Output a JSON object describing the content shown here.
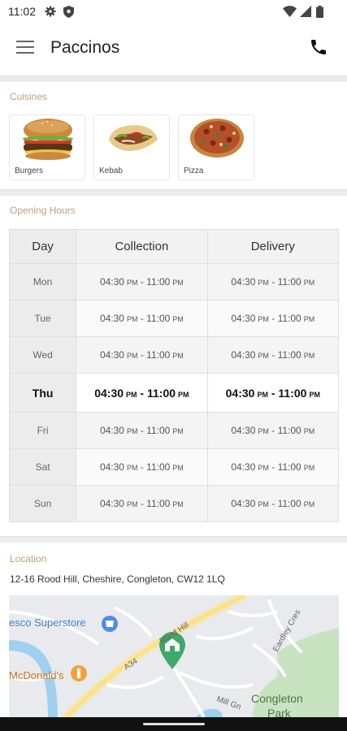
{
  "status_bar": {
    "time": "11:02"
  },
  "app_bar": {
    "title": "Paccinos"
  },
  "cuisines": {
    "label": "Cuisines",
    "items": [
      {
        "name": "Burgers",
        "icon": "burger-image"
      },
      {
        "name": "Kebab",
        "icon": "kebab-image"
      },
      {
        "name": "Pizza",
        "icon": "pizza-image"
      }
    ]
  },
  "opening_hours": {
    "label": "Opening Hours",
    "headers": [
      "Day",
      "Collection",
      "Delivery"
    ],
    "rows": [
      {
        "day": "Mon",
        "collection_open": "04:30",
        "collection_close": "11:00",
        "delivery_open": "04:30",
        "delivery_close": "11:00"
      },
      {
        "day": "Tue",
        "collection_open": "04:30",
        "collection_close": "11:00",
        "delivery_open": "04:30",
        "delivery_close": "11:00"
      },
      {
        "day": "Wed",
        "collection_open": "04:30",
        "collection_close": "11:00",
        "delivery_open": "04:30",
        "delivery_close": "11:00"
      },
      {
        "day": "Thu",
        "collection_open": "04:30",
        "collection_close": "11:00",
        "delivery_open": "04:30",
        "delivery_close": "11:00",
        "today": true
      },
      {
        "day": "Fri",
        "collection_open": "04:30",
        "collection_close": "11:00",
        "delivery_open": "04:30",
        "delivery_close": "11:00"
      },
      {
        "day": "Sat",
        "collection_open": "04:30",
        "collection_close": "11:00",
        "delivery_open": "04:30",
        "delivery_close": "11:00"
      },
      {
        "day": "Sun",
        "collection_open": "04:30",
        "collection_close": "11:00",
        "delivery_open": "04:30",
        "delivery_close": "11:00"
      }
    ],
    "suffix": "PM",
    "separator": " - "
  },
  "location": {
    "label": "Location",
    "address": "12-16 Rood Hill, Cheshire, Congleton, CW12 1LQ",
    "map": {
      "labels": {
        "tesco": "esco Superstore",
        "mcdonalds": "McDonald's",
        "rood_hill": "Rood Hill",
        "a34": "A34",
        "eardley": "Eardley Cres",
        "mill_gn": "Mill Gn",
        "congleton": "Congleton",
        "park": "Park"
      }
    }
  },
  "colors": {
    "accent_label": "#b9a27a",
    "map_land": "#e8eaed",
    "map_park": "#c8e3c0",
    "map_water": "#9fd0f0",
    "map_road_major": "#fbe59a",
    "map_pin": "#3fa86a"
  }
}
